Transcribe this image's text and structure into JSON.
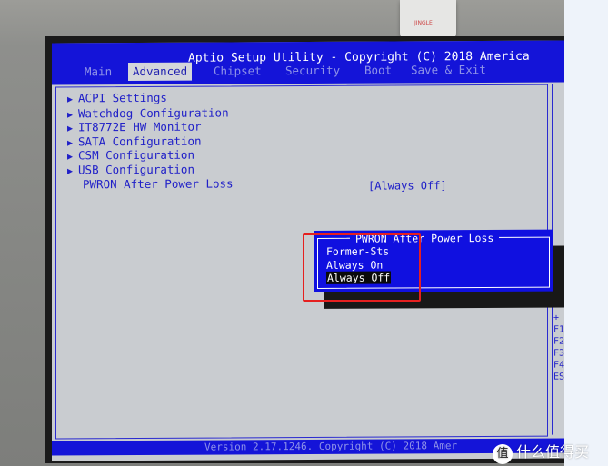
{
  "device_label": "JINGLE",
  "header": {
    "title": "Aptio Setup Utility - Copyright (C) 2018 America",
    "tabs": [
      {
        "label": "Main",
        "active": false
      },
      {
        "label": "Advanced",
        "active": true
      },
      {
        "label": "Chipset",
        "active": false
      },
      {
        "label": "Security",
        "active": false
      },
      {
        "label": "Boot",
        "active": false
      },
      {
        "label": "Save & Exit",
        "active": false
      }
    ]
  },
  "menu": {
    "items": [
      {
        "label": "ACPI Settings",
        "submenu": true
      },
      {
        "label": "Watchdog Configuration",
        "submenu": true
      },
      {
        "label": "IT8772E HW Monitor",
        "submenu": true
      },
      {
        "label": "SATA Configuration",
        "submenu": true
      },
      {
        "label": "CSM Configuration",
        "submenu": true
      },
      {
        "label": "USB Configuration",
        "submenu": true
      },
      {
        "label": "PWRON After Power Loss",
        "submenu": false
      }
    ],
    "arrow": "▶",
    "setting_value": "[Always Off]"
  },
  "popup": {
    "title": "PWRON After Power Loss",
    "options": [
      {
        "label": "Former-Sts",
        "selected": false
      },
      {
        "label": "Always On",
        "selected": false
      },
      {
        "label": "Always Off",
        "selected": true
      }
    ]
  },
  "help_keys": [
    "+",
    "F1",
    "F2",
    "F3",
    "F4",
    "ES"
  ],
  "footer": {
    "text": "Version 2.17.1246. Copyright (C) 2018 Amer"
  },
  "watermark": {
    "logo": "值",
    "text": "什么值得买"
  },
  "colors": {
    "bios_blue": "#1414d8",
    "highlight_box": "#e52020",
    "panel_gray": "#c9ccd0"
  }
}
